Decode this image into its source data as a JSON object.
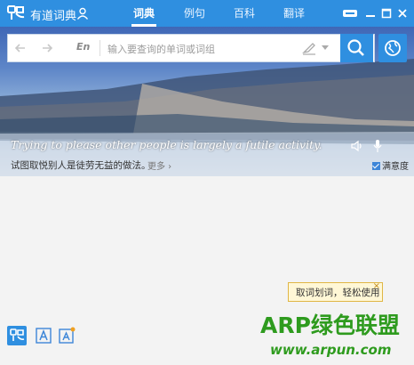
{
  "app": {
    "title": "有道词典"
  },
  "tabs": [
    {
      "label": "词典",
      "active": true
    },
    {
      "label": "例句",
      "active": false
    },
    {
      "label": "百科",
      "active": false
    },
    {
      "label": "翻译",
      "active": false
    }
  ],
  "window_controls": [
    "mini-icon",
    "minimize-icon",
    "maximize-icon",
    "close-icon"
  ],
  "search": {
    "lang": "En",
    "placeholder": "输入要查询的单词或词组",
    "value": ""
  },
  "daily": {
    "sentence_en": "Trying to please other people is largely a futile activity.",
    "sentence_cn": "试图取悦别人是徒劳无益的做法。",
    "more_label": "更多 ›",
    "satisfaction_label": "满意度",
    "satisfaction_checked": true
  },
  "tooltip": {
    "text": "取词划词，轻松使用",
    "close": "×"
  },
  "bottom_toolbar": [
    "youdao-logo-icon",
    "text-a-icon",
    "image-a-icon"
  ],
  "watermark": {
    "title": "ARP绿色联盟",
    "url": "www.arpun.com"
  },
  "colors": {
    "accent": "#2f8fe0",
    "watermark": "#2e9b1e",
    "tooltip_bg": "#fff7d6"
  }
}
